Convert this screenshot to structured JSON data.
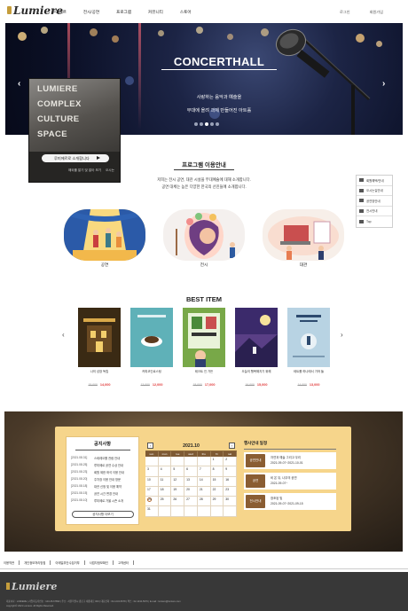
{
  "header": {
    "logo": "Lumiere",
    "nav": [
      "루미에르",
      "전시/공연",
      "프로그램",
      "커뮤니티",
      "스토어"
    ],
    "util": [
      "로그인",
      "회원가입"
    ]
  },
  "hero": {
    "title": "CONCERTHALL",
    "line1": "사랑하는 음악과 예술을",
    "line2": "무대에 올려 과제 만들어진 아트홀",
    "prev": "‹",
    "next": "›",
    "slide_count": 5,
    "active_slide": 3
  },
  "culture_card": {
    "lines": [
      "LUMIERE",
      "COMPLEX",
      "CULTURE",
      "SPACE"
    ],
    "button": "루미에르로 소개합니다",
    "meta1": "해외를 알기 및 알아 보기",
    "meta2": "오시는"
  },
  "program": {
    "title": "프로그램 이용안내",
    "desc1": "저희는 전시 공연, 대관 시설을 무대예술에 대해 소개합니다.",
    "desc2": "공연 대체는 높은 다양한 한국의 선진들에 소개합니다.",
    "items": [
      {
        "label": "공연"
      },
      {
        "label": "전시"
      },
      {
        "label": "대관"
      }
    ]
  },
  "quick_menu": [
    "회원혜택/안내",
    "오시는길안내",
    "공연장안내",
    "전시안내",
    "Top"
  ],
  "best": {
    "title": "BEST ITEM",
    "prev": "‹",
    "next": "›",
    "books": [
      {
        "name": "나의 성장 독립",
        "old": "15,000",
        "price": "14,000",
        "color": "#3a2a14"
      },
      {
        "name": "커피코인로스팅",
        "old": "13,000",
        "price": "12,000",
        "color": "#5fb1b8"
      },
      {
        "name": "테크트 인 가든",
        "old": "18,000",
        "price": "17,000",
        "color": "#78a848"
      },
      {
        "name": "오늘의 행복해지기 위해",
        "old": "16,000",
        "price": "15,000",
        "color": "#5a3f86"
      },
      {
        "name": "테트롤 하나에서 가져 들",
        "old": "14,000",
        "price": "13,000",
        "color": "#b8d3e3"
      }
    ]
  },
  "notice": {
    "title": "공지사항",
    "rows": [
      {
        "date": "[2021.08.31]",
        "text": "스테레오를 관람 안내"
      },
      {
        "date": "[2021.08.25]",
        "text": "루미에르 공연 수상 안내"
      },
      {
        "date": "[2021.08.23]",
        "text": "회원 제한 좌석 이용 안내"
      },
      {
        "date": "[2021.08.20]",
        "text": "주차장 이용 안내 방문"
      },
      {
        "date": "[2021.08.18]",
        "text": "대관 신청 및 이용 예약"
      },
      {
        "date": "[2021.08.15]",
        "text": "공연 시간 변경 안내"
      },
      {
        "date": "[2021.08.10]",
        "text": "루미에르 가을 시즌 소개"
      }
    ],
    "button": "공지사항 더보기"
  },
  "calendar": {
    "title": "2021.10",
    "prev": "‹",
    "next": "›",
    "weekdays": [
      "sun",
      "mon",
      "tue",
      "wed",
      "thu",
      "fri",
      "sat"
    ],
    "cells": [
      "",
      "",
      "",
      "",
      "",
      "1",
      "2",
      "3",
      "4",
      "5",
      "6",
      "7",
      "8",
      "9",
      "10",
      "11",
      "12",
      "13",
      "14",
      "15",
      "16",
      "17",
      "18",
      "19",
      "20",
      "21",
      "22",
      "23",
      "24",
      "25",
      "26",
      "27",
      "28",
      "29",
      "30",
      "31",
      "",
      "",
      "",
      "",
      "",
      ""
    ],
    "marked": "24"
  },
  "events": {
    "title": "행사안내 일정",
    "items": [
      {
        "tag": "공연안내",
        "line1": "자연과 예술 그리고 우리",
        "line2": "2021-09-07~2021-10-01"
      },
      {
        "tag": "공연",
        "line1": "비 온 뒤, 나무의 공연",
        "line2": "2021-09-07~"
      },
      {
        "tag": "전시안내",
        "line1": "창조된 빛",
        "line2": "2021-09-07~2021-09-15"
      }
    ]
  },
  "footer": {
    "links": [
      "이용약관",
      "개인정보처리방침",
      "이메일무단수집거부",
      "사업자정보확인",
      "고객센터"
    ],
    "logo": "Lumiere",
    "info": "대표이사 : LUMIERE  |  사업자등록번호 : 123-45-67890  |  주소 : 서울특별시 종로구 세종대로 000  |  대표전화 : 02-1234-5678  |  팩스 : 02-1234-5679  |  E-mail : lumiere@lumiere.com",
    "copy": "copyright© 2021 Lumiere. All Rights Reserved."
  }
}
